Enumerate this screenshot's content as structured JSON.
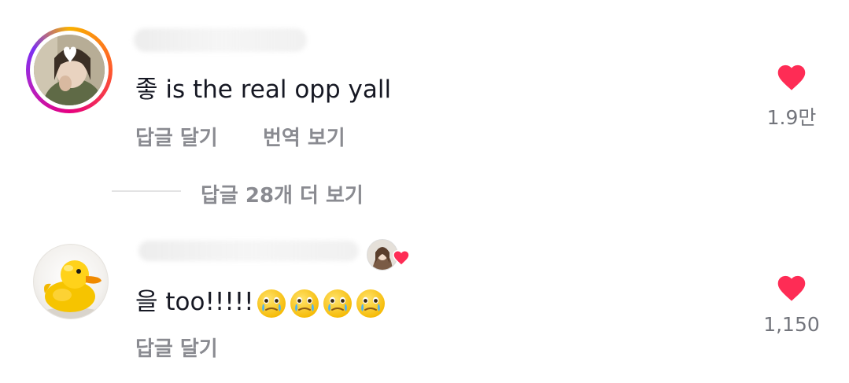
{
  "comments": [
    {
      "text": "좋 is the real opp yall",
      "reply_label": "답글 달기",
      "translate_label": "번역 보기",
      "like_count": "1.9만",
      "view_replies_label": "답글 28개 더 보기"
    },
    {
      "text": "을 too!!!!!",
      "reply_label": "답글 달기",
      "like_count": "1,150",
      "emoji_count": 4
    }
  ],
  "colors": {
    "like": "#fe2c55",
    "secondary_text": "#8a8b91",
    "primary_text": "#161823"
  },
  "icons": {
    "like": "heart-icon",
    "emoji": "face-holding-back-tears-emoji",
    "creator_liked": "creator-liked-heart-icon"
  }
}
